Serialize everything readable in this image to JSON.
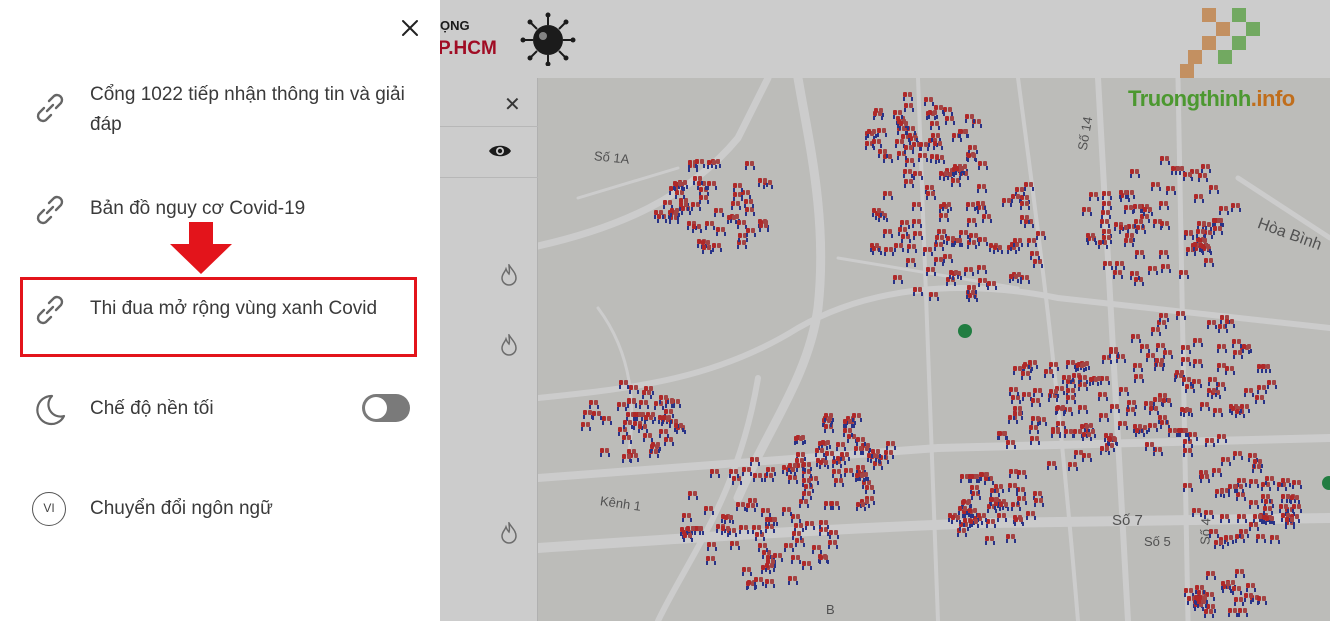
{
  "header": {
    "brand_small": "ỌNG",
    "brand_big": "P.HCM"
  },
  "watermark": {
    "name": "Truongthinh",
    "tld": ".info"
  },
  "map": {
    "street_labels": [
      "Số 1A",
      "Số 14",
      "Hòa Bình",
      "Kênh 1",
      "Số 7",
      "Số 5",
      "Số 4",
      "B"
    ]
  },
  "drawer": {
    "items": [
      {
        "label": "Cổng 1022 tiếp nhận thông tin và giải đáp",
        "icon": "link-icon"
      },
      {
        "label": "Bản đồ nguy cơ Covid-19",
        "icon": "link-icon"
      },
      {
        "label": "Thi đua mở rộng vùng xanh Covid",
        "icon": "link-icon"
      },
      {
        "label": "Chế độ nền tối",
        "icon": "moon-icon",
        "toggle": false
      },
      {
        "label": "Chuyển đổi ngôn ngữ",
        "icon": "language-badge",
        "badge": "VI"
      }
    ]
  },
  "colors": {
    "highlight": "#e3141b",
    "brand_red": "#c8102e",
    "watermark_green": "#5fbf3c",
    "watermark_orange": "#f08a24"
  }
}
